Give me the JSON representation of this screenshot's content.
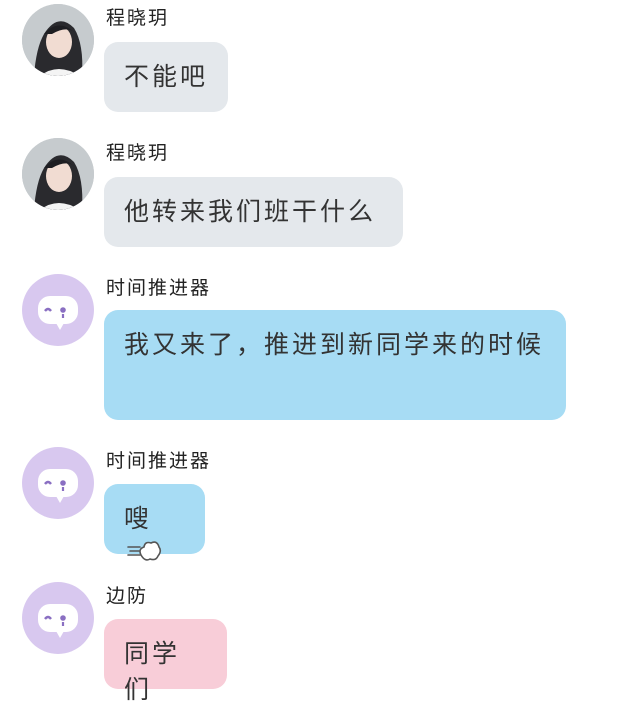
{
  "messages": [
    {
      "sender": "程晓玥",
      "avatar": "girl-photo-avatar",
      "text": "不能吧",
      "bubble_color": "#e4e8ec"
    },
    {
      "sender": "程晓玥",
      "avatar": "girl-photo-avatar",
      "text": "他转来我们班干什么",
      "bubble_color": "#e4e8ec"
    },
    {
      "sender": "时间推进器",
      "avatar": "chat-bubble-avatar",
      "text": "我又来了，推进到新同学来的时候",
      "bubble_color": "#a7dcf4"
    },
    {
      "sender": "时间推进器",
      "avatar": "chat-bubble-avatar",
      "text": "嗖",
      "icon": "dash-puff-icon",
      "bubble_color": "#a7dcf4"
    },
    {
      "sender": "边防",
      "avatar": "chat-bubble-avatar",
      "text": "同学们",
      "bubble_color": "#f8cdd8"
    }
  ]
}
